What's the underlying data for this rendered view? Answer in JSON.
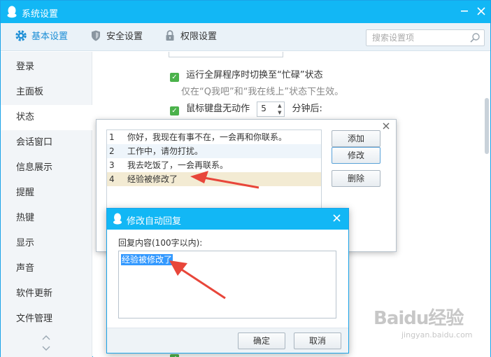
{
  "window": {
    "title": "系统设置"
  },
  "tabs": [
    {
      "label": "基本设置",
      "icon": "gear-icon"
    },
    {
      "label": "安全设置",
      "icon": "shield-icon"
    },
    {
      "label": "权限设置",
      "icon": "lock-icon"
    }
  ],
  "search": {
    "placeholder": "搜索设置项"
  },
  "sidebar": {
    "items": [
      {
        "label": "登录"
      },
      {
        "label": "主面板"
      },
      {
        "label": "状态"
      },
      {
        "label": "会话窗口"
      },
      {
        "label": "信息展示"
      },
      {
        "label": "提醒"
      },
      {
        "label": "热键"
      },
      {
        "label": "显示"
      },
      {
        "label": "声音"
      },
      {
        "label": "软件更新"
      },
      {
        "label": "文件管理"
      }
    ],
    "active": "状态"
  },
  "content": {
    "fullscreen_option": "运行全屏程序时切换至“忙碌”状态",
    "fullscreen_note": "仅在“Q我吧”和“我在线上”状态下生效。",
    "idle_prefix": "鼠标键盘无动作",
    "idle_value": "5",
    "idle_suffix": "分钟后:"
  },
  "reply_dialog": {
    "list": [
      {
        "num": "1",
        "text": "你好，我现在有事不在，一会再和你联系。"
      },
      {
        "num": "2",
        "text": "工作中，请勿打扰。"
      },
      {
        "num": "3",
        "text": "我去吃饭了，一会再联系。"
      },
      {
        "num": "4",
        "text": "经验被修改了"
      }
    ],
    "buttons": {
      "add": "添加",
      "edit": "修改",
      "delete": "删除"
    }
  },
  "edit_dialog": {
    "title": "修改自动回复",
    "label": "回复内容(100字以内):",
    "value": "经验被修改了",
    "buttons": {
      "ok": "确定",
      "cancel": "取消"
    }
  },
  "watermark": {
    "main": "Baidu经验",
    "sub": "jingyan.baidu.com"
  },
  "colors": {
    "titlebar": "#12b7f5",
    "accent": "#1d8fd6",
    "check": "#4bb24b",
    "selection": "#3399ff",
    "annotation": "#e8463a"
  }
}
